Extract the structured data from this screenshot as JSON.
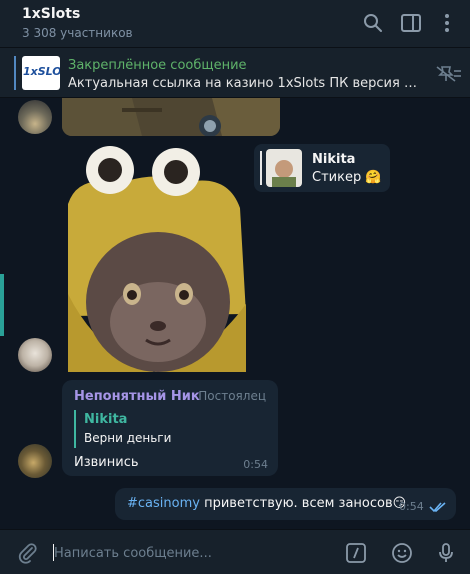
{
  "header": {
    "title": "1xSlots",
    "subtitle": "3 308 участников",
    "icons": [
      "search-icon",
      "sidebar-toggle-icon",
      "more-icon"
    ]
  },
  "pinned": {
    "title": "Закреплённое сообщение",
    "text": "Актуальная ссылка на казино 1xSlots ПК версия -  http...",
    "thumb_text": "1xSLOT"
  },
  "messages": {
    "forwarded": {
      "name": "Nikita",
      "text": "Стикер 🤗"
    },
    "incoming": {
      "sender": "Непонятный Ник",
      "role": "Постоялец",
      "reply_name": "Nikita",
      "reply_text": "Верни деньги",
      "text": "Извинись",
      "time": "0:54"
    },
    "outgoing": {
      "hashtag": "#casinomy",
      "text": " приветствую. всем заносов😏",
      "time": "0:54"
    }
  },
  "composer": {
    "placeholder": "Написать сообщение..."
  },
  "colors": {
    "bg": "#0e1621",
    "panel": "#17212b",
    "bubble": "#182533",
    "accent_name": "#a695e7",
    "reply_accent": "#3fb7a1",
    "link": "#6ab3f3",
    "pinned_title": "#5fb36a"
  }
}
